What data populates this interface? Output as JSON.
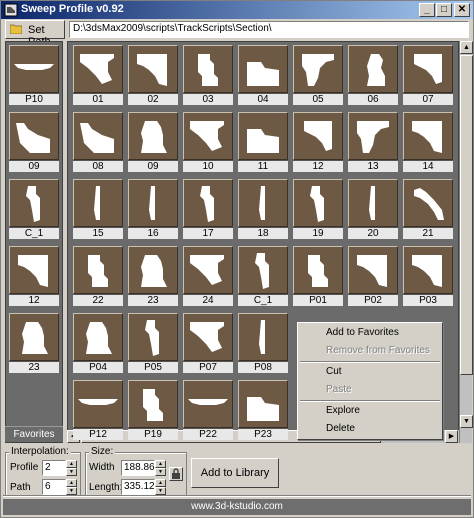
{
  "window": {
    "title": "Sweep Profile v0.92",
    "controls": {
      "minimize": "_",
      "maximize": "□",
      "close": "✕"
    }
  },
  "toolbar": {
    "set_path_label": "Set Path",
    "path_value": "D:\\3dsMax2009\\scripts\\TrackScripts\\Section\\"
  },
  "favorites": {
    "tab_label": "Favorites",
    "items": [
      {
        "label": "P10",
        "shape": "s10"
      },
      {
        "label": "09",
        "shape": "s3"
      },
      {
        "label": "C_1",
        "shape": "s12"
      },
      {
        "label": "12",
        "shape": "s2"
      },
      {
        "label": "23",
        "shape": "s7"
      }
    ]
  },
  "library": {
    "rows": [
      [
        {
          "label": "01",
          "shape": "s1"
        },
        {
          "label": "02",
          "shape": "s2"
        },
        {
          "label": "03",
          "shape": "s4"
        },
        {
          "label": "04",
          "shape": "s5"
        },
        {
          "label": "05",
          "shape": "s6"
        },
        {
          "label": "06",
          "shape": "s8"
        },
        {
          "label": "07",
          "shape": "s9"
        }
      ],
      [
        {
          "label": "08",
          "shape": "s3"
        },
        {
          "label": "09",
          "shape": "s7"
        },
        {
          "label": "10",
          "shape": "s1"
        },
        {
          "label": "11",
          "shape": "s5"
        },
        {
          "label": "12",
          "shape": "s9"
        },
        {
          "label": "13",
          "shape": "s6"
        },
        {
          "label": "14",
          "shape": "s2"
        }
      ],
      [
        {
          "label": "15",
          "shape": "s11"
        },
        {
          "label": "16",
          "shape": "s11"
        },
        {
          "label": "17",
          "shape": "s12"
        },
        {
          "label": "18",
          "shape": "s11"
        },
        {
          "label": "19",
          "shape": "s12"
        },
        {
          "label": "20",
          "shape": "s11"
        },
        {
          "label": "21",
          "shape": "s13"
        }
      ],
      [
        {
          "label": "22",
          "shape": "s4"
        },
        {
          "label": "23",
          "shape": "s7"
        },
        {
          "label": "24",
          "shape": "s1"
        },
        {
          "label": "C_1",
          "shape": "s12"
        },
        {
          "label": "P01",
          "shape": "s4"
        },
        {
          "label": "P02",
          "shape": "s2"
        },
        {
          "label": "P03",
          "shape": "s2"
        }
      ],
      [
        {
          "label": "P04",
          "shape": "s7"
        },
        {
          "label": "P05",
          "shape": "s12"
        },
        {
          "label": "P07",
          "shape": "s1"
        },
        {
          "label": "P08",
          "shape": "s11"
        }
      ],
      [
        {
          "label": "P12",
          "shape": "s10"
        },
        {
          "label": "P19",
          "shape": "s4"
        },
        {
          "label": "P22",
          "shape": "s10"
        },
        {
          "label": "P23",
          "shape": "s5"
        }
      ]
    ]
  },
  "context_menu": {
    "items": [
      {
        "label": "Add to Favorites",
        "enabled": true
      },
      {
        "label": "Remove from Favorites",
        "enabled": false
      },
      {
        "label": "Cut",
        "enabled": true
      },
      {
        "label": "Paste",
        "enabled": false
      },
      {
        "label": "Explore",
        "enabled": true
      },
      {
        "label": "Delete",
        "enabled": true
      }
    ]
  },
  "interpolation": {
    "title": "Interpolation:",
    "profile_label": "Profile",
    "profile_value": "2",
    "path_label": "Path",
    "path_value": "6"
  },
  "size": {
    "title": "Size:",
    "width_label": "Width",
    "width_value": "188.86",
    "length_label": "Length:",
    "length_value": "335.12"
  },
  "add_library_label": "Add to Library",
  "footer_text": "www.3d-kstudio.com",
  "colors": {
    "thumb_bg": "#6e5a44",
    "panel_bg": "#6b6b6b",
    "title_start": "#0a246a",
    "title_end": "#a6caf0"
  },
  "icons": {
    "set_path": "folder-icon",
    "lock": "lock-icon",
    "app": "app-icon"
  }
}
